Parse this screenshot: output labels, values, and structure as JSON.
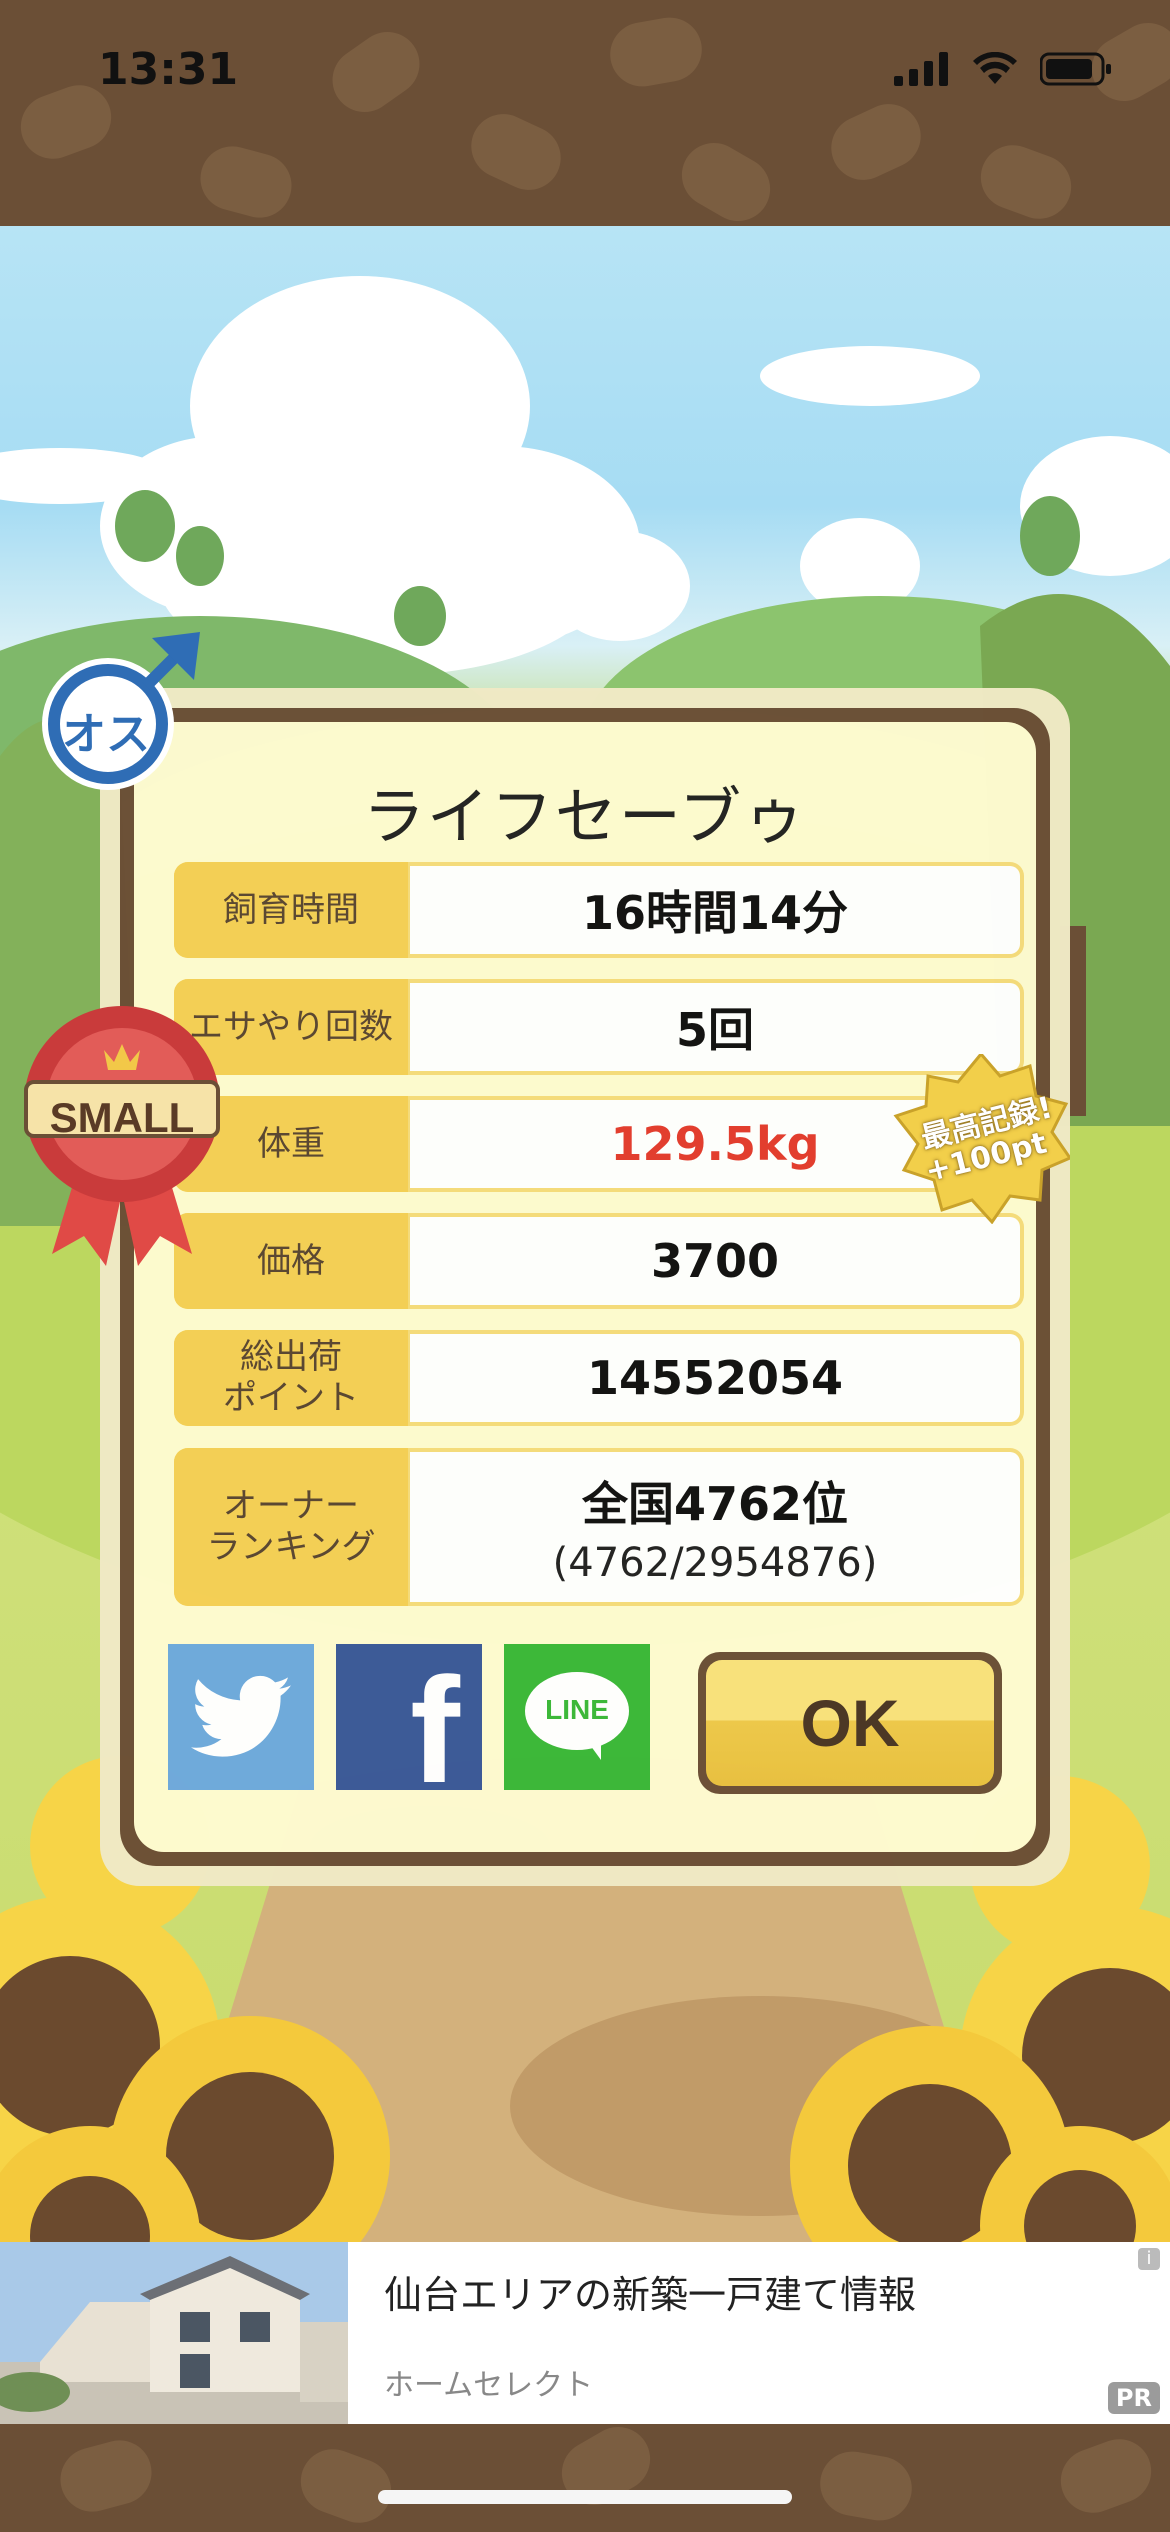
{
  "status": {
    "time": "13:31"
  },
  "pet": {
    "name": "ライフセーブゥ",
    "gender_badge": "オス",
    "size_badge": "SMALL",
    "record_badge": {
      "line1": "最高記録!",
      "line2": "+100pt"
    }
  },
  "stats": [
    {
      "label": "飼育時間",
      "value": "16時間14分"
    },
    {
      "label": "エサやり回数",
      "value": "5回"
    },
    {
      "label": "体重",
      "value": "129.5kg"
    },
    {
      "label": "価格",
      "value": "3700"
    },
    {
      "label": "総出荷\nポイント",
      "value": "14552054"
    },
    {
      "label": "オーナー\nランキング",
      "value": "全国4762位",
      "sub": "(4762/2954876)"
    }
  ],
  "share": {
    "twitter": "twitter-icon",
    "facebook": "f",
    "line": "LINE"
  },
  "ok_label": "OK",
  "ad": {
    "title": "仙台エリアの新築一戸建て情報",
    "sponsor": "ホームセレクト",
    "pr": "PR",
    "info": "i"
  },
  "colors": {
    "frame": "#6b4f36",
    "panel": "#fefbd0",
    "label_bg": "#f5cf55",
    "weight_red": "#e33b2e",
    "twitter": "#6ea9dd",
    "facebook": "#3b5998",
    "line": "#3bb838"
  }
}
